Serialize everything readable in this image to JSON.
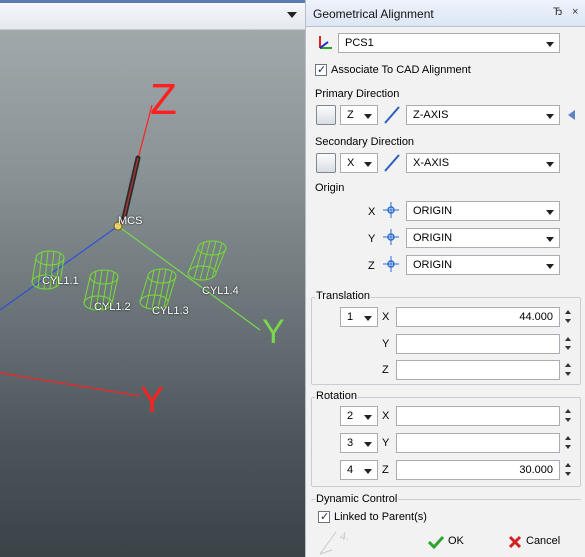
{
  "viewport": {
    "axis_z": "Z",
    "axis_y_big": "Y",
    "axis_y_bottom": "Y",
    "mcs_label": "MCS",
    "cylinders": [
      "CYL1.1",
      "CYL1.2",
      "CYL1.3",
      "CYL1.4"
    ]
  },
  "panel": {
    "title": "Geometrical Alignment",
    "pin_glyph": "Ђ",
    "close_glyph": "×",
    "coordinate_system": "PCS1",
    "associate_label": "Associate To CAD Alignment",
    "associate_checked": true,
    "primary": {
      "label": "Primary Direction",
      "axis": "Z",
      "value": "Z-AXIS"
    },
    "secondary": {
      "label": "Secondary Direction",
      "axis": "X",
      "value": "X-AXIS"
    },
    "origin": {
      "label": "Origin",
      "rows": [
        {
          "axis": "X",
          "value": "ORIGIN"
        },
        {
          "axis": "Y",
          "value": "ORIGIN"
        },
        {
          "axis": "Z",
          "value": "ORIGIN"
        }
      ]
    },
    "translation": {
      "label": "Translation",
      "order": "1",
      "rows": [
        {
          "axis": "X",
          "value": "44.000"
        },
        {
          "axis": "Y",
          "value": ""
        },
        {
          "axis": "Z",
          "value": ""
        }
      ]
    },
    "rotation": {
      "label": "Rotation",
      "rows": [
        {
          "order": "2",
          "axis": "X",
          "value": ""
        },
        {
          "order": "3",
          "axis": "Y",
          "value": ""
        },
        {
          "order": "4",
          "axis": "Z",
          "value": "30.000"
        }
      ]
    },
    "dynamic": {
      "label": "Dynamic Control",
      "linked_label": "Linked to Parent(s)",
      "linked_checked": true
    },
    "buttons": {
      "ok": "OK",
      "cancel": "Cancel"
    }
  },
  "colors": {
    "axis_red": "#ff2020",
    "axis_green": "#7ad84a",
    "cyl_green": "#77dd33",
    "axis_blue": "#3050d0",
    "check_green": "#2fa32f",
    "cancel_red": "#d21f1f"
  },
  "icons": [
    "triad-icon",
    "chevron-down-icon",
    "pin-icon",
    "close-icon",
    "pick-icon",
    "line-icon",
    "crosshair-icon",
    "spinner-icon",
    "check-icon",
    "x-icon",
    "triad-watermark-icon"
  ]
}
